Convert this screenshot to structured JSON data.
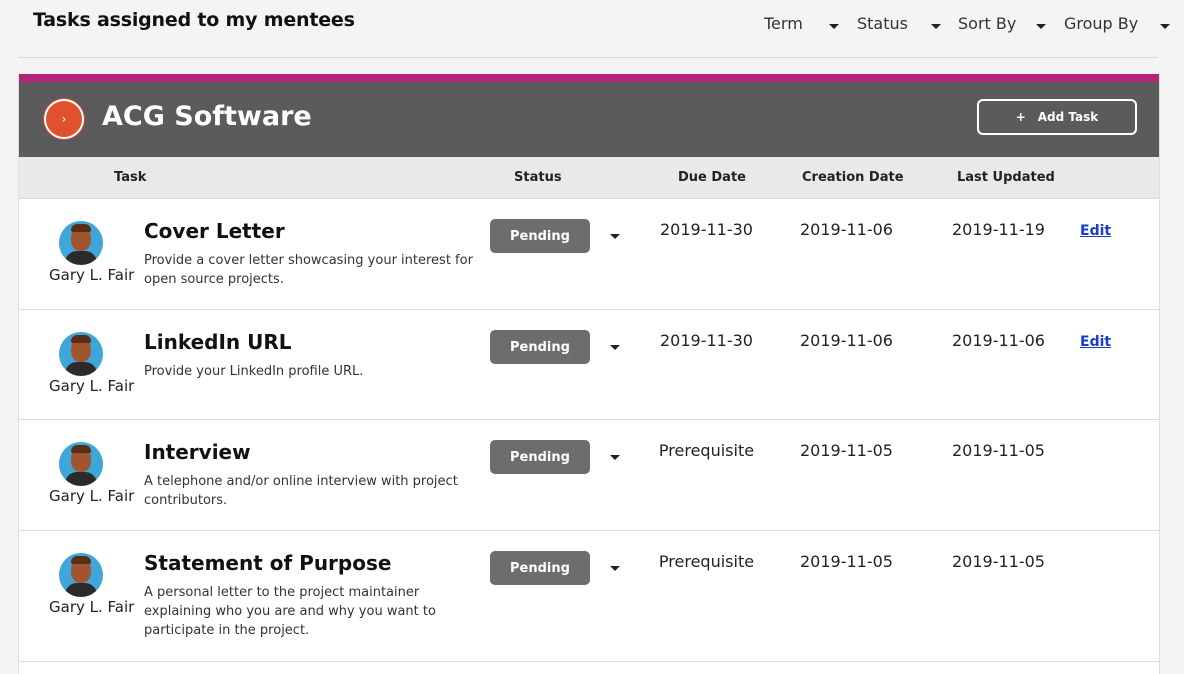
{
  "page": {
    "title": "Tasks assigned to my mentees"
  },
  "filters": [
    {
      "label": "Term"
    },
    {
      "label": "Status"
    },
    {
      "label": "Sort By"
    },
    {
      "label": "Group By"
    }
  ],
  "org": {
    "name": "ACG Software",
    "badge_icon": "chevron-right-icon",
    "badge_glyph": "›",
    "add_task_label": "Add Task",
    "add_task_plus": "+",
    "accent_color": "#b5237a",
    "header_color": "#5b5b5b"
  },
  "columns": {
    "task": "Task",
    "status": "Status",
    "due_date": "Due Date",
    "creation_date": "Creation Date",
    "last_updated": "Last Updated"
  },
  "rows": [
    {
      "mentee": "Gary L. Fair",
      "title": "Cover Letter",
      "description": "Provide a cover letter showcasing your interest for open source projects.",
      "status": "Pending",
      "due_date": "2019-11-30",
      "creation_date": "2019-11-06",
      "last_updated": "2019-11-19",
      "edit_label": "Edit"
    },
    {
      "mentee": "Gary L. Fair",
      "title": "LinkedIn URL",
      "description": "Provide your LinkedIn profile URL.",
      "status": "Pending",
      "due_date": "2019-11-30",
      "creation_date": "2019-11-06",
      "last_updated": "2019-11-06",
      "edit_label": "Edit"
    },
    {
      "mentee": "Gary L. Fair",
      "title": "Interview",
      "description": "A telephone and/or online interview with project contributors.",
      "status": "Pending",
      "due_date": "Prerequisite",
      "creation_date": "2019-11-05",
      "last_updated": "2019-11-05",
      "edit_label": ""
    },
    {
      "mentee": "Gary L. Fair",
      "title": "Statement of Purpose",
      "description": "A personal letter to the project maintainer explaining who you are and why you want to participate in the project.",
      "status": "Pending",
      "due_date": "Prerequisite",
      "creation_date": "2019-11-05",
      "last_updated": "2019-11-05",
      "edit_label": ""
    }
  ]
}
